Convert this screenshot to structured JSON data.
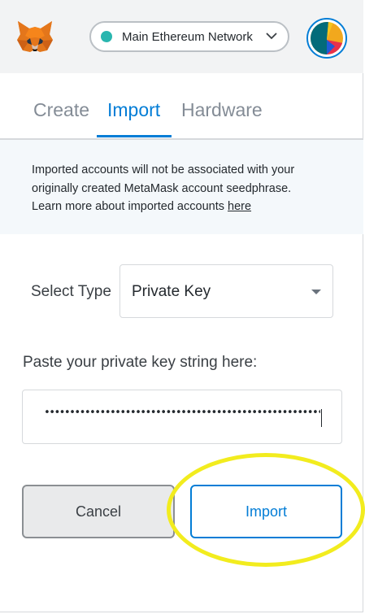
{
  "header": {
    "network_label": "Main Ethereum Network",
    "network_dot_color": "#29b6af"
  },
  "tabs": [
    {
      "label": "Create",
      "active": false
    },
    {
      "label": "Import",
      "active": true
    },
    {
      "label": "Hardware",
      "active": false
    }
  ],
  "info": {
    "line1": "Imported accounts will not be associated with your",
    "line2": "originally created MetaMask account seedphrase.",
    "line3_prefix": "Learn more about imported accounts ",
    "link_text": "here"
  },
  "select": {
    "label": "Select Type",
    "value": "Private Key"
  },
  "private_key": {
    "label": "Paste your private key string here:",
    "masked_value": "••••••••••••••••••••••••••••••••••••••••••••••••••••••••••••••••"
  },
  "buttons": {
    "cancel": "Cancel",
    "import": "Import"
  },
  "colors": {
    "accent": "#037dd6",
    "highlight": "#f2ec1e"
  },
  "icons": [
    "metamask-fox-icon",
    "chevron-down-icon",
    "account-avatar-icon",
    "dropdown-caret-icon"
  ]
}
